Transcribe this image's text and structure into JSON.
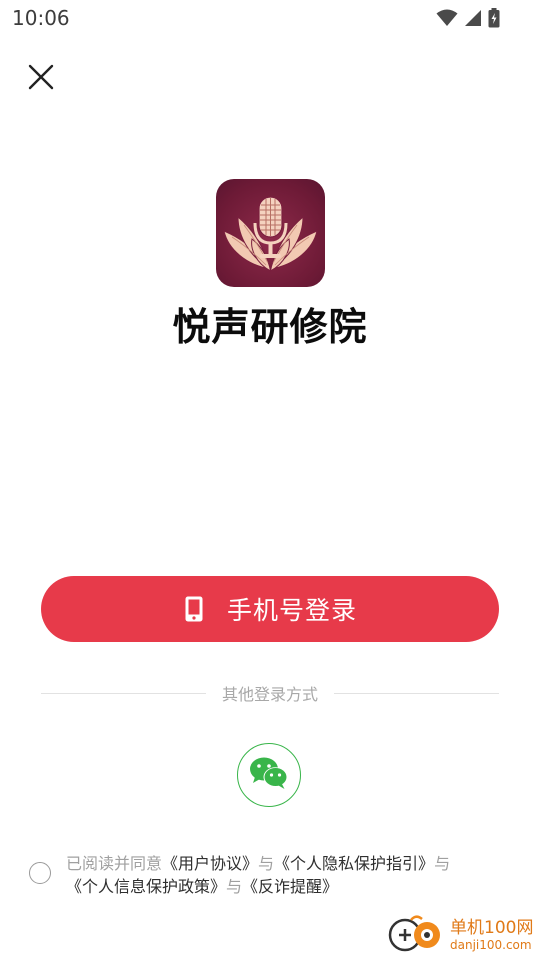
{
  "status_bar": {
    "time": "10:06"
  },
  "header": {
    "close_icon": "close-icon"
  },
  "app": {
    "name": "悦声研修院",
    "logo_icon": "microphone-lotus-logo",
    "logo_color": "#7a1f3e"
  },
  "login": {
    "phone_label": "手机号登录",
    "phone_icon": "mobile-phone-icon",
    "accent_color": "#e73a4a"
  },
  "other_methods": {
    "label": "其他登录方式",
    "wechat_icon": "wechat-icon"
  },
  "agreement": {
    "prefix": "已阅读并同意",
    "user_agreement": "《用户协议》",
    "and1": "与",
    "privacy_guide": "《个人隐私保护指引》",
    "and2": "与",
    "info_policy": "《个人信息保护政策》",
    "and3": "与",
    "anti_fraud": "《反诈提醒》"
  },
  "watermark": {
    "cn": "单机100网",
    "en": "danji100.com"
  }
}
